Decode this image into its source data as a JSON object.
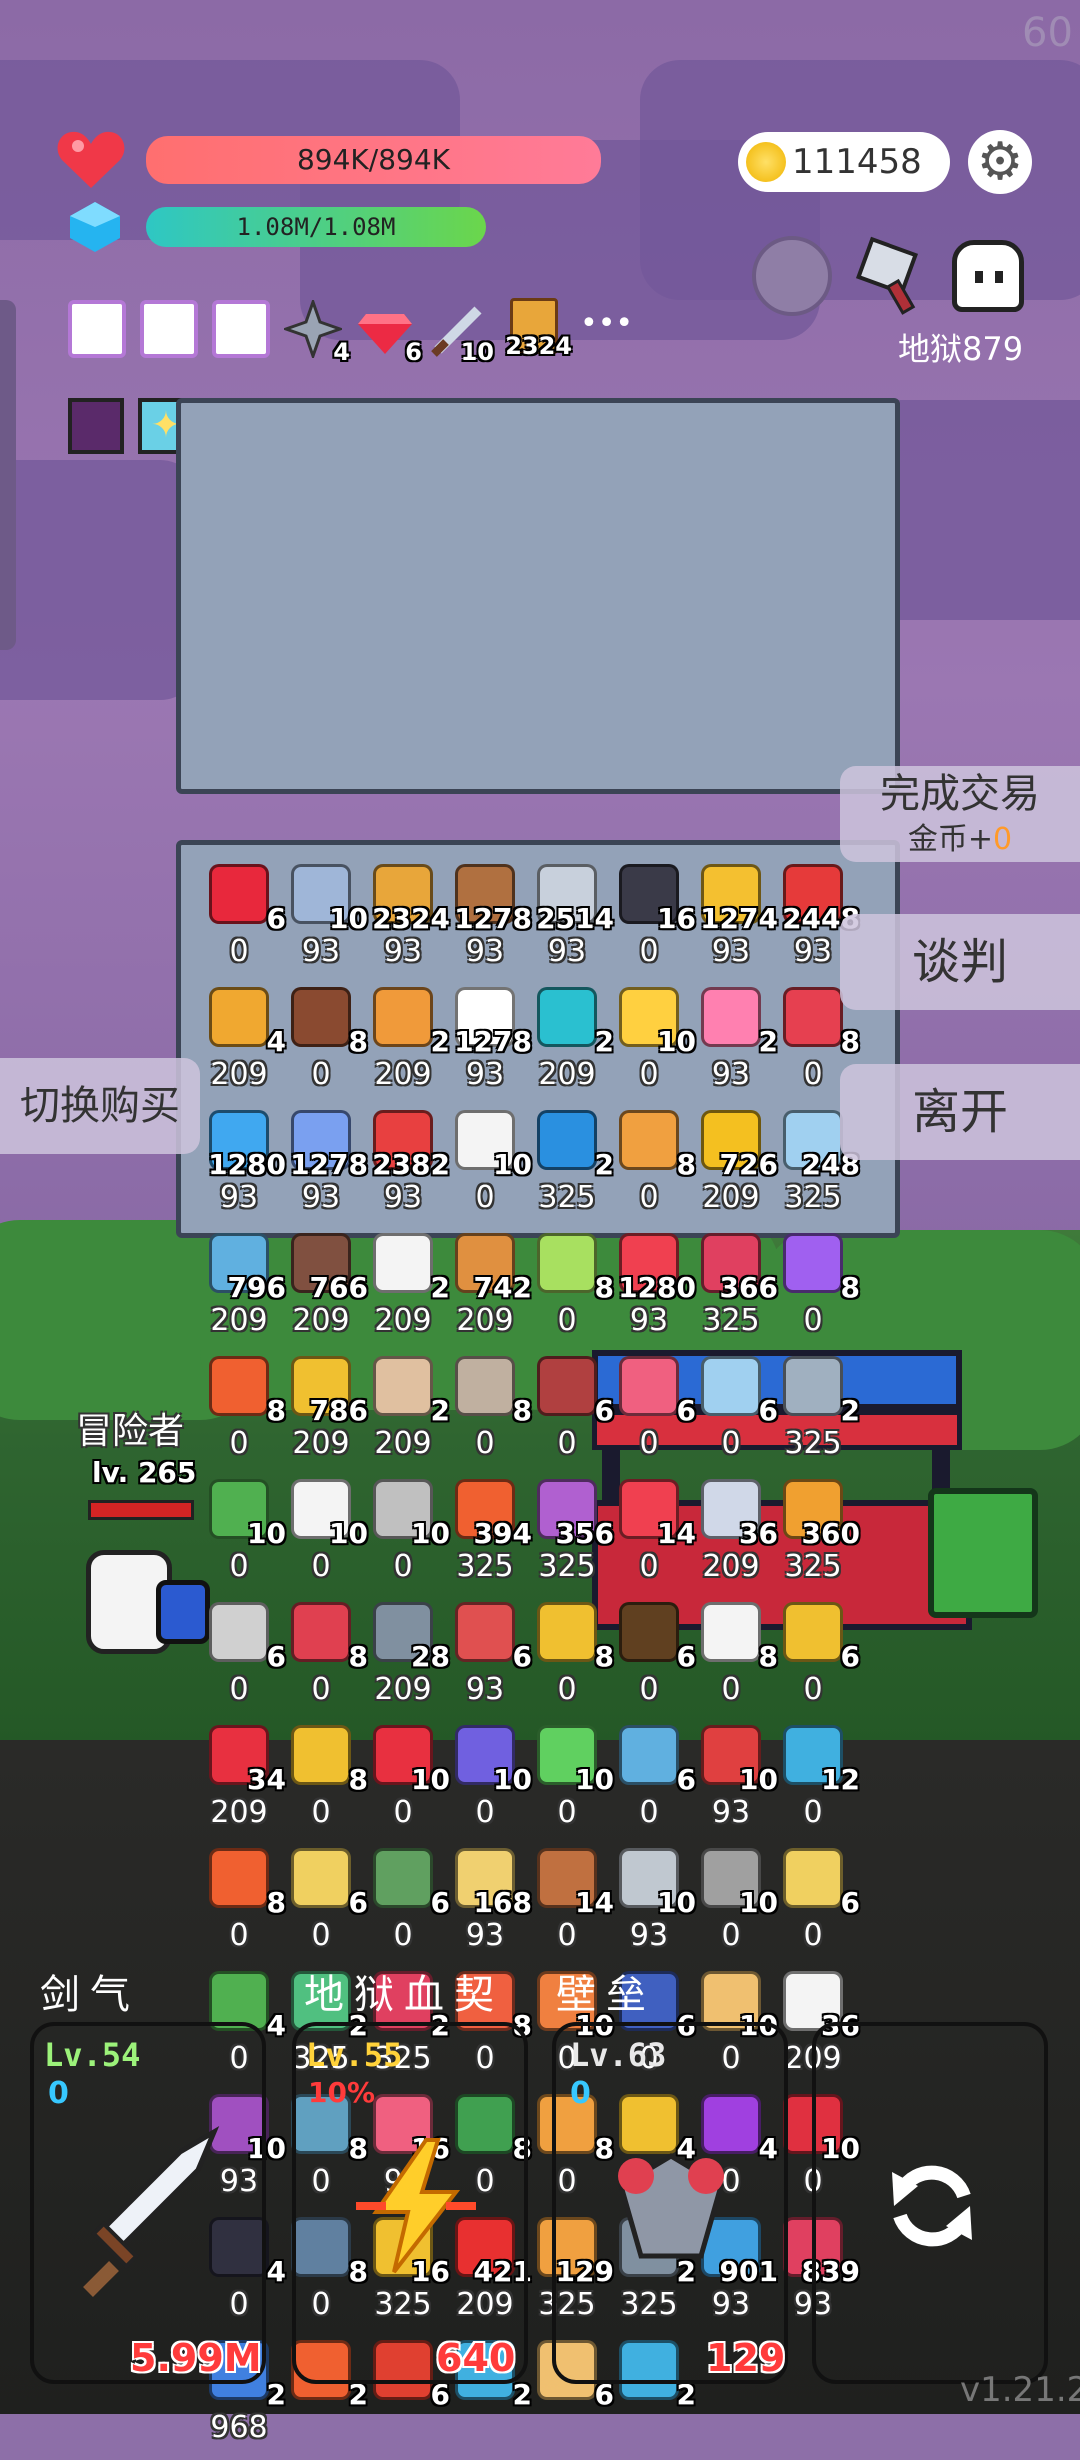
{
  "fps": "60",
  "version": "v1.21.2",
  "player": {
    "hp": "894K/894K",
    "mana": "1.08M/1.08M",
    "coins": "111458"
  },
  "buffs": [
    {
      "name": "card-icon",
      "count": ""
    },
    {
      "name": "card-icon",
      "count": ""
    },
    {
      "name": "card-icon",
      "count": ""
    },
    {
      "name": "shuriken-icon",
      "count": "4"
    },
    {
      "name": "ruby-icon",
      "count": "6"
    },
    {
      "name": "dagger-icon",
      "count": "10"
    },
    {
      "name": "tome-icon",
      "count": "2324"
    }
  ],
  "more": "•••",
  "hell_label": "地狱879",
  "buttons": {
    "complete_trade": "完成交易",
    "trade_gold_label": "金币+",
    "trade_gold_value": "0",
    "negotiate": "谈判",
    "leave": "离开",
    "switch_buy": "切换购买"
  },
  "adventurer": {
    "label": "冒险者",
    "level": "lv. 265"
  },
  "items": [
    {
      "icon": "ruby-icon",
      "color": "#e8283c",
      "qty": "6",
      "price": "0"
    },
    {
      "icon": "dagger-icon",
      "color": "#9fb6d8",
      "qty": "10",
      "price": "93"
    },
    {
      "icon": "tome-icon",
      "color": "#e8a63a",
      "qty": "2324",
      "price": "93"
    },
    {
      "icon": "shield-round-icon",
      "color": "#b07040",
      "qty": "1278",
      "price": "93"
    },
    {
      "icon": "sword-icon",
      "color": "#c8d0dc",
      "qty": "2514",
      "price": "93"
    },
    {
      "icon": "bat-icon",
      "color": "#3a3a48",
      "qty": "16",
      "price": "0"
    },
    {
      "icon": "beer-icon",
      "color": "#f4c030",
      "qty": "1274",
      "price": "93"
    },
    {
      "icon": "apple-icon",
      "color": "#e63a3a",
      "qty": "2448",
      "price": "93"
    },
    {
      "icon": "scroll-icon",
      "color": "#f0a830",
      "qty": "4",
      "price": "209"
    },
    {
      "icon": "mushroom-icon",
      "color": "#8a4a30",
      "qty": "8",
      "price": "0"
    },
    {
      "icon": "briefcase-icon",
      "color": "#f09a3a",
      "qty": "2",
      "price": "209"
    },
    {
      "icon": "flower-icon",
      "color": "#ffffff",
      "qty": "1278",
      "price": "93"
    },
    {
      "icon": "target-icon",
      "color": "#2ac0d0",
      "qty": "2",
      "price": "209"
    },
    {
      "icon": "idea-icon",
      "color": "#ffd040",
      "qty": "10",
      "price": "0"
    },
    {
      "icon": "sundae-icon",
      "color": "#ff80b0",
      "qty": "2",
      "price": "93"
    },
    {
      "icon": "shield-user-icon",
      "color": "#e64050",
      "qty": "8",
      "price": "0"
    },
    {
      "icon": "chat-bubble-icon",
      "color": "#40a8f0",
      "qty": "1280",
      "price": "93"
    },
    {
      "icon": "eraser-icon",
      "color": "#7aa0f0",
      "qty": "1278",
      "price": "93"
    },
    {
      "icon": "watermelon-icon",
      "color": "#e84040",
      "qty": "2382",
      "price": "93"
    },
    {
      "icon": "checklist-icon",
      "color": "#f4f4f4",
      "qty": "10",
      "price": "0"
    },
    {
      "icon": "star-card-icon",
      "color": "#2a90e0",
      "qty": "2",
      "price": "325"
    },
    {
      "icon": "menu-book-icon",
      "color": "#f0a040",
      "qty": "8",
      "price": "0"
    },
    {
      "icon": "sunflower-icon",
      "color": "#f4c020",
      "qty": "726",
      "price": "209"
    },
    {
      "icon": "jacket-icon",
      "color": "#a0d0f0",
      "qty": "248",
      "price": "325"
    },
    {
      "icon": "pen-icon",
      "color": "#60b0e0",
      "qty": "796",
      "price": "209"
    },
    {
      "icon": "door-icon",
      "color": "#805040",
      "qty": "766",
      "price": "209"
    },
    {
      "icon": "playing-cards-icon",
      "color": "#f4f4f4",
      "qty": "2",
      "price": "209"
    },
    {
      "icon": "bow-icon",
      "color": "#e09040",
      "qty": "742",
      "price": "209"
    },
    {
      "icon": "phone-icon",
      "color": "#a8e060",
      "qty": "8",
      "price": "0"
    },
    {
      "icon": "pill-icon",
      "color": "#f04050",
      "qty": "1280",
      "price": "93"
    },
    {
      "icon": "jam-jar-icon",
      "color": "#e04060",
      "qty": "366",
      "price": "325"
    },
    {
      "icon": "magic-wand-icon",
      "color": "#a060f0",
      "qty": "8",
      "price": "0"
    },
    {
      "icon": "fire-ring-icon",
      "color": "#f06030",
      "qty": "8",
      "price": "0"
    },
    {
      "icon": "pineapple-icon",
      "color": "#f0c030",
      "qty": "786",
      "price": "209"
    },
    {
      "icon": "sparkle-icon",
      "color": "#e0c0a0",
      "qty": "2",
      "price": "209"
    },
    {
      "icon": "gravestone-icon",
      "color": "#c0b0a0",
      "qty": "8",
      "price": "0"
    },
    {
      "icon": "hook-icon",
      "color": "#b04040",
      "qty": "6",
      "price": "0"
    },
    {
      "icon": "calendar-icon",
      "color": "#f06080",
      "qty": "6",
      "price": "0"
    },
    {
      "icon": "frame-icon",
      "color": "#a0d0f0",
      "qty": "6",
      "price": "0"
    },
    {
      "icon": "compass-icon",
      "color": "#a0b0c0",
      "qty": "2",
      "price": "325"
    },
    {
      "icon": "frog-icon",
      "color": "#50b050",
      "qty": "10",
      "price": "0"
    },
    {
      "icon": "garlic-icon",
      "color": "#f4f4f4",
      "qty": "10",
      "price": "0"
    },
    {
      "icon": "spike-ball-icon",
      "color": "#c0c0c0",
      "qty": "10",
      "price": "0"
    },
    {
      "icon": "flag-icon",
      "color": "#f06030",
      "qty": "394",
      "price": "325"
    },
    {
      "icon": "tulip-icon",
      "color": "#b060d0",
      "qty": "356",
      "price": "325"
    },
    {
      "icon": "map-pin-icon",
      "color": "#f04050",
      "qty": "14",
      "price": "0"
    },
    {
      "icon": "envelope-icon",
      "color": "#d0d8e8",
      "qty": "36",
      "price": "209"
    },
    {
      "icon": "pinecone-icon",
      "color": "#f0a030",
      "qty": "360",
      "price": "325"
    },
    {
      "icon": "scythe-icon",
      "color": "#d0d0d0",
      "qty": "6",
      "price": "0"
    },
    {
      "icon": "shield-icon",
      "color": "#e04050",
      "qty": "8",
      "price": "0"
    },
    {
      "icon": "brain-icon",
      "color": "#8090a0",
      "qty": "28",
      "price": "209"
    },
    {
      "icon": "armor-icon",
      "color": "#e05050",
      "qty": "6",
      "price": "93"
    },
    {
      "icon": "goblet-icon",
      "color": "#f0c030",
      "qty": "8",
      "price": "0"
    },
    {
      "icon": "eye-icon",
      "color": "#604020",
      "qty": "6",
      "price": "0"
    },
    {
      "icon": "speech-icon",
      "color": "#f4f4f4",
      "qty": "8",
      "price": "0"
    },
    {
      "icon": "star-wand-icon",
      "color": "#f0c030",
      "qty": "6",
      "price": "0"
    },
    {
      "icon": "strawberry-icon",
      "color": "#e83040",
      "qty": "34",
      "price": "209"
    },
    {
      "icon": "ring-icon",
      "color": "#f0c030",
      "qty": "8",
      "price": "0"
    },
    {
      "icon": "amanita-icon",
      "color": "#e83040",
      "qty": "10",
      "price": "0"
    },
    {
      "icon": "chest-icon",
      "color": "#7060e0",
      "qty": "10",
      "price": "0"
    },
    {
      "icon": "molecule-icon",
      "color": "#60d060",
      "qty": "10",
      "price": "0"
    },
    {
      "icon": "safety-pin-icon",
      "color": "#60b0e0",
      "qty": "6",
      "price": "0"
    },
    {
      "icon": "thermometer-icon",
      "color": "#e04040",
      "qty": "10",
      "price": "93"
    },
    {
      "icon": "scroll-blue-icon",
      "color": "#40b0e0",
      "qty": "12",
      "price": "0"
    },
    {
      "icon": "flame-icon",
      "color": "#f06030",
      "qty": "8",
      "price": "0"
    },
    {
      "icon": "note-paper-icon",
      "color": "#f0d060",
      "qty": "6",
      "price": "0"
    },
    {
      "icon": "zombie-icon",
      "color": "#60a060",
      "qty": "6",
      "price": "0"
    },
    {
      "icon": "map-icon",
      "color": "#f0d070",
      "qty": "168",
      "price": "93"
    },
    {
      "icon": "drumstick-icon",
      "color": "#c07040",
      "qty": "14",
      "price": "0"
    },
    {
      "icon": "crossed-swords-icon",
      "color": "#c0c8d0",
      "qty": "10",
      "price": "93"
    },
    {
      "icon": "hand-icon",
      "color": "#a0a0a0",
      "qty": "10",
      "price": "0"
    },
    {
      "icon": "angel-icon",
      "color": "#f0d060",
      "qty": "6",
      "price": "0"
    },
    {
      "icon": "cauldron-icon",
      "color": "#50b050",
      "qty": "4",
      "price": "0"
    },
    {
      "icon": "potion-green-icon",
      "color": "#50c080",
      "qty": "2",
      "price": "325"
    },
    {
      "icon": "heart-potion-icon",
      "color": "#e04060",
      "qty": "2",
      "price": "325"
    },
    {
      "icon": "candy-icon",
      "color": "#f06040",
      "qty": "8",
      "price": "0"
    },
    {
      "icon": "chef-icon",
      "color": "#f08040",
      "qty": "10",
      "price": "0"
    },
    {
      "icon": "book-blue-icon",
      "color": "#4060c0",
      "qty": "6",
      "price": "0"
    },
    {
      "icon": "parchment-icon",
      "color": "#f0c070",
      "qty": "10",
      "price": "0"
    },
    {
      "icon": "egg-icon",
      "color": "#f4f4f4",
      "qty": "36",
      "price": "209"
    },
    {
      "icon": "plum-icon",
      "color": "#a050c0",
      "qty": "10",
      "price": "93"
    },
    {
      "icon": "wrench-icon",
      "color": "#60a0c0",
      "qty": "8",
      "price": "0"
    },
    {
      "icon": "peach-icon",
      "color": "#f06080",
      "qty": "16",
      "price": "93"
    },
    {
      "icon": "snake-icon",
      "color": "#40a050",
      "qty": "8",
      "price": "0"
    },
    {
      "icon": "person-icon",
      "color": "#f0a040",
      "qty": "8",
      "price": "0"
    },
    {
      "icon": "tools-icon",
      "color": "#f0c030",
      "qty": "4",
      "price": "0"
    },
    {
      "icon": "crystal-ball-icon",
      "color": "#a040e0",
      "qty": "4",
      "price": "0"
    },
    {
      "icon": "magnet-icon",
      "color": "#e03040",
      "qty": "10",
      "price": "0"
    },
    {
      "icon": "pot-icon",
      "color": "#303040",
      "qty": "4",
      "price": "0"
    },
    {
      "icon": "mortar-icon",
      "color": "#6080a0",
      "qty": "8",
      "price": "0"
    },
    {
      "icon": "lightning-icon",
      "color": "#f0c030",
      "qty": "16",
      "price": "325"
    },
    {
      "icon": "red-card-icon",
      "color": "#e83030",
      "qty": "421",
      "price": "209"
    },
    {
      "icon": "feather-icon",
      "color": "#f0a040",
      "qty": "129",
      "price": "325"
    },
    {
      "icon": "spiky-icon",
      "color": "#8090a0",
      "qty": "2",
      "price": "325"
    },
    {
      "icon": "flask-icon",
      "color": "#40a0e0",
      "qty": "901",
      "price": "93"
    },
    {
      "icon": "test-tube-icon",
      "color": "#e04060",
      "qty": "839",
      "price": "93"
    },
    {
      "icon": "crosshair-icon",
      "color": "#4080e0",
      "qty": "2",
      "price": "968"
    },
    {
      "icon": "fireball-icon",
      "color": "#f06030",
      "qty": "2",
      "price": ""
    },
    {
      "icon": "fire-card-icon",
      "color": "#e04030",
      "qty": "6",
      "price": ""
    },
    {
      "icon": "potion-blue-icon",
      "color": "#40b0e0",
      "qty": "2",
      "price": ""
    },
    {
      "icon": "treasure-map-icon",
      "color": "#f0c070",
      "qty": "6",
      "price": ""
    },
    {
      "icon": "swirl-icon",
      "color": "#40b0e0",
      "qty": "2",
      "price": ""
    }
  ],
  "skills": [
    {
      "title": "剑气",
      "level": "Lv.54",
      "blue": "0",
      "stat": "5.99M",
      "icon": "sword-icon"
    },
    {
      "title": "地狱血契",
      "level": "Lv.55",
      "pct": "10%",
      "stat": "640",
      "icon": "lightning-icon"
    },
    {
      "title": "壁垒",
      "level": "Lv.63",
      "blue": "0",
      "stat": "129",
      "icon": "bulwark-icon"
    },
    {
      "title": "",
      "icon": "refresh-icon"
    }
  ]
}
